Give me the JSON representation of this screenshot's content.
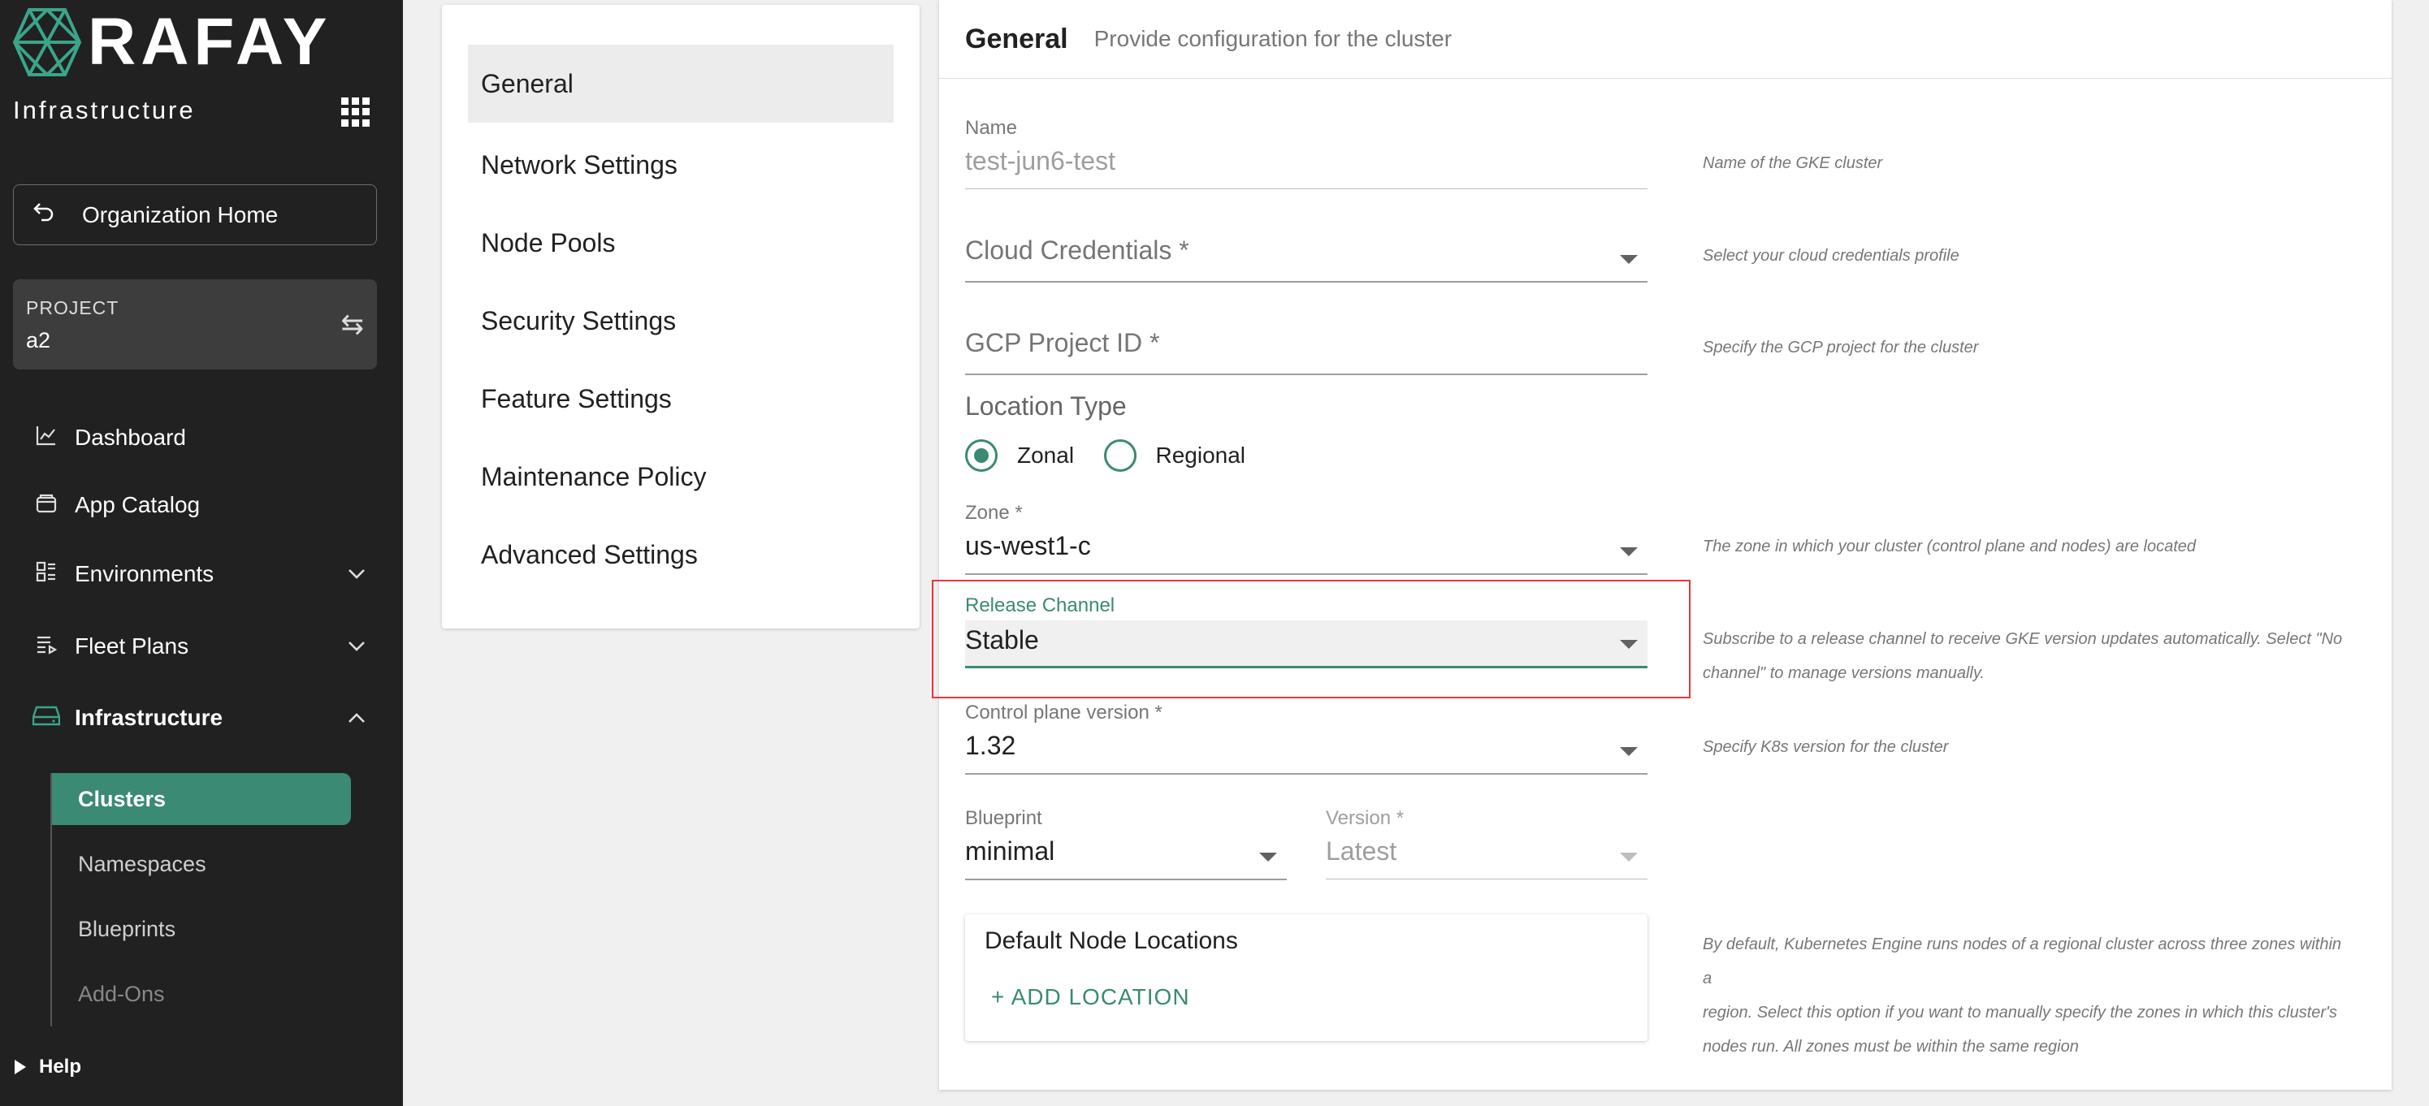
{
  "sidebar": {
    "logo_text": "RAFAY",
    "product": "Infrastructure",
    "org_home": "Organization Home",
    "project_label": "PROJECT",
    "project_name": "a2",
    "nav": [
      {
        "label": "Dashboard",
        "icon": "chart-line-icon"
      },
      {
        "label": "App Catalog",
        "icon": "catalog-icon"
      },
      {
        "label": "Environments",
        "icon": "environments-icon"
      },
      {
        "label": "Fleet Plans",
        "icon": "fleet-plans-icon"
      },
      {
        "label": "Infrastructure",
        "icon": "infrastructure-icon"
      }
    ],
    "sub_nav": [
      "Clusters",
      "Namespaces",
      "Blueprints",
      "Add-Ons"
    ],
    "help": "Help"
  },
  "settings": {
    "items": [
      "General",
      "Network Settings",
      "Node Pools",
      "Security Settings",
      "Feature Settings",
      "Maintenance Policy",
      "Advanced Settings"
    ]
  },
  "main": {
    "title": "General",
    "subtitle": "Provide configuration for the cluster",
    "name": {
      "label": "Name",
      "value": "test-jun6-test",
      "hint": "Name of the GKE cluster"
    },
    "cloud_credentials": {
      "label": "Cloud Credentials *",
      "hint": "Select your cloud credentials profile"
    },
    "gcp_project": {
      "label": "GCP Project ID *",
      "hint": "Specify the GCP project for the cluster"
    },
    "location_type": {
      "label": "Location Type",
      "options": [
        "Zonal",
        "Regional"
      ],
      "selected": "Zonal"
    },
    "zone": {
      "label": "Zone *",
      "value": "us-west1-c",
      "hint": "The zone in which your cluster (control plane and nodes) are located"
    },
    "release_channel": {
      "label": "Release Channel",
      "value": "Stable",
      "hint_line1": "Subscribe to a release channel to receive GKE version updates automatically. Select \"No",
      "hint_line2": "channel\" to manage versions manually."
    },
    "control_plane": {
      "label": "Control plane version *",
      "value": "1.32",
      "hint": "Specify K8s version for the cluster"
    },
    "blueprint": {
      "label": "Blueprint",
      "value": "minimal"
    },
    "version": {
      "label": "Version *",
      "value": "Latest"
    },
    "node_locations": {
      "title": "Default Node Locations",
      "add_label": "+ ADD  LOCATION",
      "hint_line1": "By default, Kubernetes Engine runs nodes of a regional cluster across three zones within a",
      "hint_line2": "region. Select this option if you want to manually specify the zones in which this cluster's",
      "hint_line3": "nodes run. All zones must be within the same region"
    }
  },
  "colors": {
    "accent": "#3a8a74",
    "sidebar_bg": "#212121",
    "highlight": "#e53935"
  }
}
